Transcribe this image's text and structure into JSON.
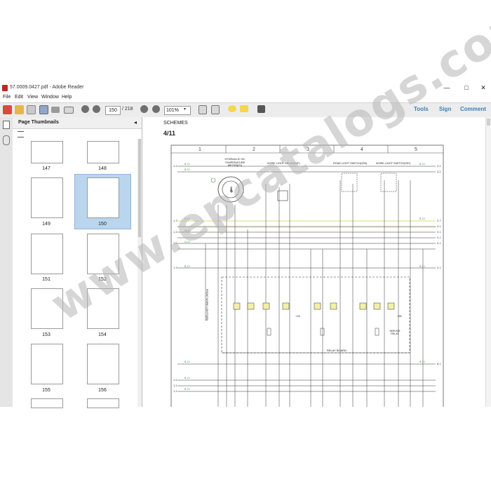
{
  "window": {
    "title": "57.0009.0427.pdf - Adobe Reader",
    "minimize_glyph": "—",
    "maximize_glyph": "□",
    "close_glyph": "✕"
  },
  "menu": [
    "File",
    "Edit",
    "View",
    "Window",
    "Help"
  ],
  "toolbar": {
    "current_page": "150",
    "total_pages": "/ 218",
    "zoom": "101%",
    "tools_label": "Tools",
    "sign_label": "Sign",
    "comment_label": "Comment"
  },
  "thumbnails_panel": {
    "title": "Page Thumbnails",
    "collapse_glyph": "◂",
    "pages": [
      "147",
      "148",
      "149",
      "150",
      "151",
      "152",
      "153",
      "154",
      "155",
      "156"
    ],
    "selected": "150"
  },
  "document": {
    "section_title": "SCHEMES",
    "page_label": "4/11",
    "columns": [
      "1",
      "2",
      "3",
      "4",
      "5"
    ],
    "labels": {
      "gauge": "HYDRAULIC OIL TEMPERATURE METER(P1)",
      "work_relay": "WORK LIGHT RELAY(K4F)",
      "road_switch": "ROAD LIGHT SWITCH(S93)",
      "work_switch": "WORK LIGHT SWITCH(S57)",
      "relay_board": "RELAY BOARD",
      "service_relay": "SERVICE RELAY",
      "plus15": "+15",
      "plus30": "+30",
      "vertical": "FRONT WORK LIGHTS(E6)"
    }
  },
  "watermark": "www.epcatalogs.com",
  "colors": {
    "wire_green": "#3d9a3d",
    "wire_black": "#333333",
    "wire_yellow": "#e3e39a",
    "accent_blue": "#3c7fb8",
    "selection": "#b9d6ee"
  }
}
